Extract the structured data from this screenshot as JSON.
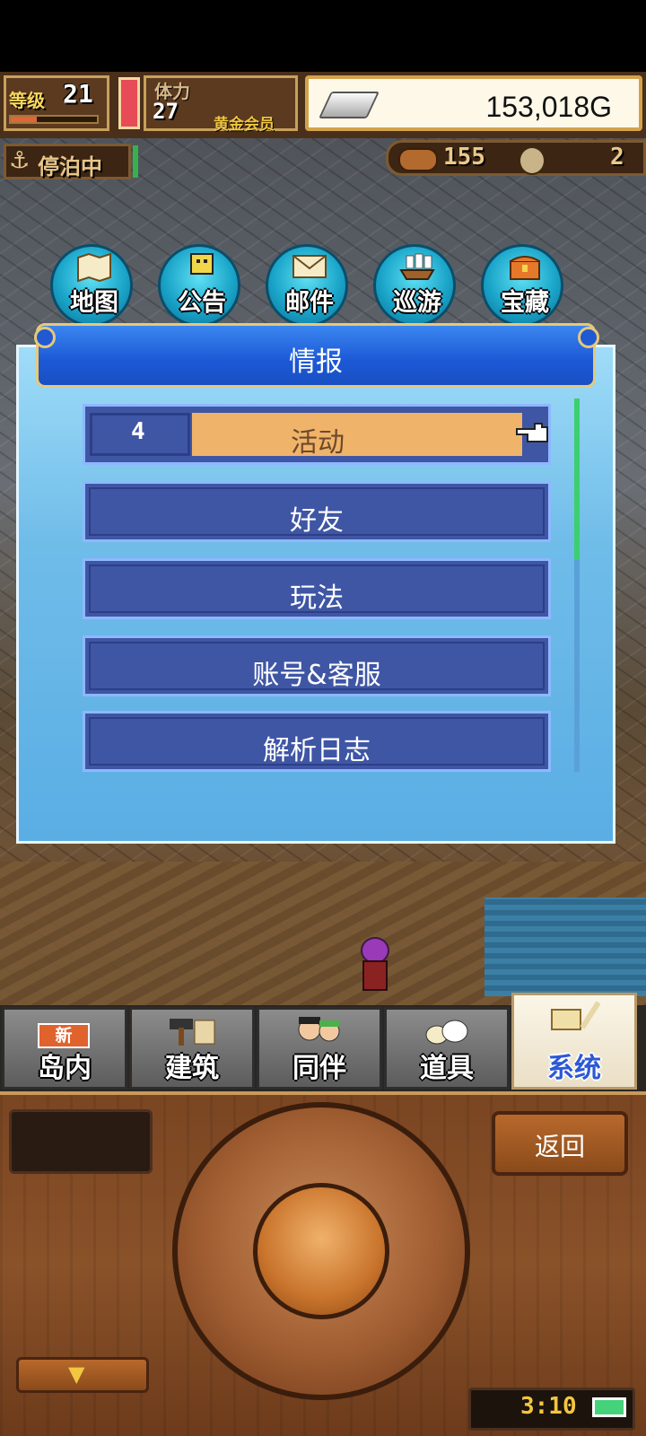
{
  "hud": {
    "level_label": "等级",
    "level_value": "21",
    "level_progress": 0.3,
    "stamina_label": "体力",
    "stamina_value": "27",
    "member_badge": "黄金会员",
    "gold_value": "153,018G",
    "dock_status": "停泊中",
    "wood_value": "155",
    "medal_value": "2"
  },
  "circle_menu": [
    {
      "label": "地图",
      "icon": "map-icon"
    },
    {
      "label": "公告",
      "icon": "bulletin-icon"
    },
    {
      "label": "邮件",
      "icon": "mail-icon"
    },
    {
      "label": "巡游",
      "icon": "ship-icon"
    },
    {
      "label": "宝藏",
      "icon": "treasure-chest-icon"
    }
  ],
  "dialog": {
    "title": "情报",
    "items": [
      {
        "label": "活动",
        "count": "4",
        "selected": true
      },
      {
        "label": "好友"
      },
      {
        "label": "玩法"
      },
      {
        "label": "账号&客服"
      },
      {
        "label": "解析日志"
      }
    ]
  },
  "tabs": [
    {
      "label": "岛内",
      "badge": "新",
      "icon": "island-icon"
    },
    {
      "label": "建筑",
      "icon": "hammer-icon"
    },
    {
      "label": "同伴",
      "icon": "crew-icon"
    },
    {
      "label": "道具",
      "icon": "items-icon"
    },
    {
      "label": "系统",
      "icon": "scroll-quill-icon",
      "active": true
    }
  ],
  "controller": {
    "back_label": "返回",
    "clock": "3:10",
    "battery": "full"
  },
  "colors": {
    "dialog_header": "#1c58d6",
    "menu_row": "#3f56a5",
    "selected_row": "#f0b36a",
    "gold_text": "#f2c640"
  }
}
